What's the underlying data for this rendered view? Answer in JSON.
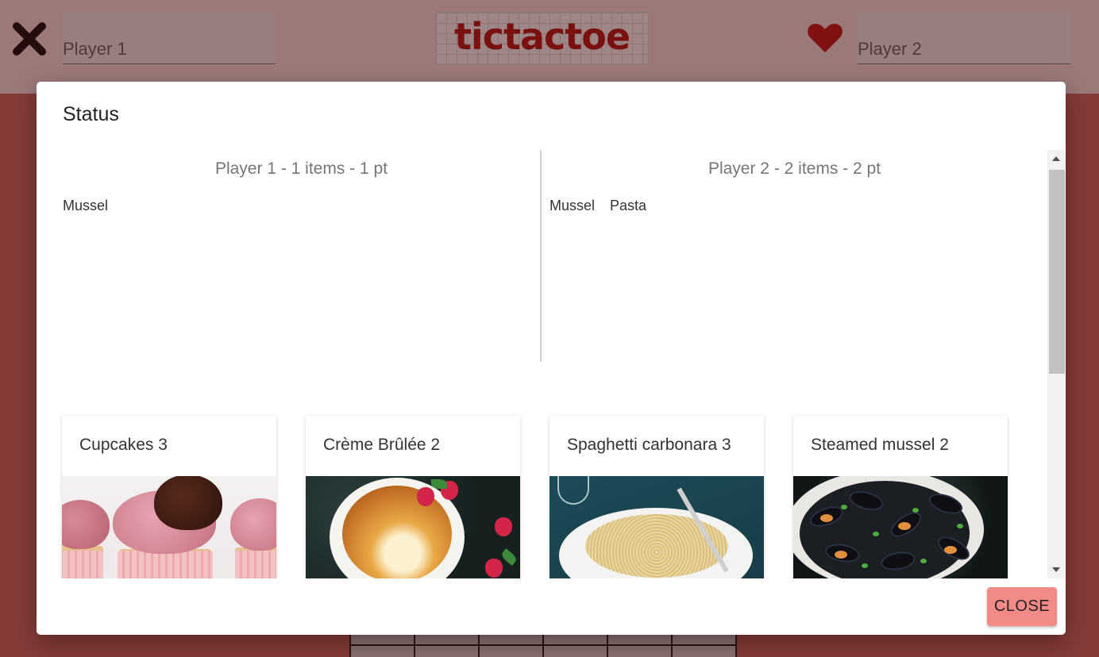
{
  "header": {
    "logo_text": "tictactoe",
    "player1_placeholder": "Player 1",
    "player2_placeholder": "Player 2",
    "player1_icon": "x-icon",
    "player2_icon": "heart-icon"
  },
  "modal": {
    "title": "Status",
    "players": [
      {
        "heading": "Player 1 - 1 items - 1 pt",
        "items": [
          "Mussel"
        ]
      },
      {
        "heading": "Player 2 - 2 items - 2 pt",
        "items": [
          "Mussel",
          "Pasta"
        ]
      }
    ],
    "cards": [
      {
        "title": "Cupcakes 3"
      },
      {
        "title": "Crème Brûlée 2"
      },
      {
        "title": "Spaghetti carbonara 3"
      },
      {
        "title": "Steamed mussel 2"
      }
    ],
    "close_label": "CLOSE"
  },
  "colors": {
    "accent": "#f28b88",
    "logo": "#b21a1a",
    "page_background": "#c96a66"
  }
}
